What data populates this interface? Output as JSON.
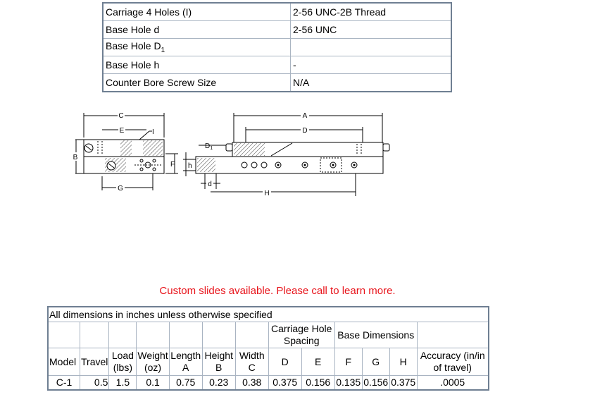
{
  "spec_table": {
    "rows": [
      {
        "label": "Carriage 4 Holes (I)",
        "value": "2-56 UNC-2B Thread"
      },
      {
        "label": "Base Hole d",
        "value": "2-56 UNC"
      },
      {
        "label": "Base Hole D",
        "label_sub": "1",
        "value": ""
      },
      {
        "label": "Base Hole h",
        "value": "-"
      },
      {
        "label": "Counter Bore Screw Size",
        "value": "N/A"
      }
    ]
  },
  "drawing": {
    "labels": {
      "A": "A",
      "B": "B",
      "C": "C",
      "D": "D",
      "E": "E",
      "F": "F",
      "G": "G",
      "H": "H",
      "I": "I",
      "d": "d",
      "h": "h",
      "D1": "D",
      "D1_sub": "1"
    },
    "colors": {
      "stroke": "#000000",
      "hatch": "#444444"
    }
  },
  "note": "Custom slides available. Please call to learn more.",
  "dims_table": {
    "caption": "All dimensions in inches unless otherwise specified",
    "group_carriage": "Carriage Hole Spacing",
    "group_base": "Base Dimensions",
    "headers": {
      "model": "Model",
      "travel": "Travel",
      "load": "Load (lbs)",
      "weight": "Weight (oz)",
      "length": "Length A",
      "height": "Height B",
      "width": "Width C",
      "D": "D",
      "E": "E",
      "F": "F",
      "G": "G",
      "H": "H",
      "accuracy": "Accuracy (in/in of travel)"
    },
    "row": {
      "model": "C-1",
      "travel": "0.5",
      "load": "1.5",
      "weight": "0.1",
      "length": "0.75",
      "height": "0.23",
      "width": "0.38",
      "D": "0.375",
      "E": "0.156",
      "F": "0.135",
      "G": "0.156",
      "H": "0.375",
      "accuracy": ".0005"
    }
  }
}
